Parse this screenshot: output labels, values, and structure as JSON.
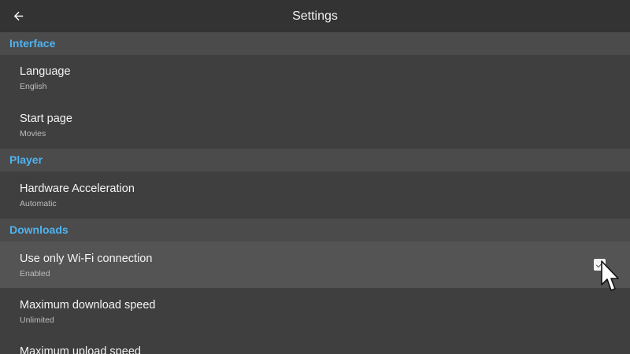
{
  "header": {
    "title": "Settings",
    "back_icon": "arrow-left-icon"
  },
  "sections": [
    {
      "name": "Interface",
      "items": [
        {
          "label": "Language",
          "value": "English"
        },
        {
          "label": "Start page",
          "value": "Movies"
        }
      ]
    },
    {
      "name": "Player",
      "items": [
        {
          "label": "Hardware Acceleration",
          "value": "Automatic"
        }
      ]
    },
    {
      "name": "Downloads",
      "items": [
        {
          "label": "Use only Wi-Fi connection",
          "value": "Enabled",
          "checked": true
        },
        {
          "label": "Maximum download speed",
          "value": "Unlimited"
        },
        {
          "label": "Maximum upload speed",
          "value": ""
        }
      ]
    }
  ],
  "colors": {
    "accent": "#4fb3f0",
    "background": "#3f3f3f",
    "section_bg": "#4b4b4b",
    "topbar_bg": "#333333",
    "highlight_row": "#545454"
  }
}
